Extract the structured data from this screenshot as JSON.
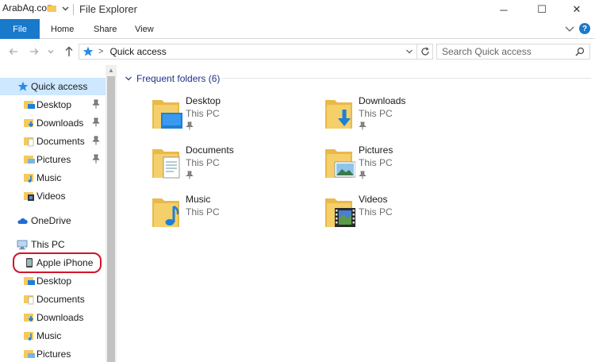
{
  "watermark": "ArabAq.com",
  "window": {
    "title": "File Explorer"
  },
  "window_controls": {
    "minimize": "─",
    "maximize": "☐",
    "close": "✕"
  },
  "ribbon": {
    "tabs": [
      {
        "label": "File",
        "active": true
      },
      {
        "label": "Home"
      },
      {
        "label": "Share"
      },
      {
        "label": "View"
      }
    ],
    "help": "?"
  },
  "address": {
    "crumb_sep": ">",
    "location": "Quick access",
    "search_placeholder": "Search Quick access"
  },
  "navpane": {
    "items": [
      {
        "label": "Quick access",
        "icon": "star-icon",
        "selected": true
      },
      {
        "label": "Desktop",
        "icon": "folder-desktop-icon",
        "pinned": true
      },
      {
        "label": "Downloads",
        "icon": "folder-downloads-icon",
        "pinned": true
      },
      {
        "label": "Documents",
        "icon": "folder-documents-icon",
        "pinned": true
      },
      {
        "label": "Pictures",
        "icon": "folder-pictures-icon",
        "pinned": true
      },
      {
        "label": "Music",
        "icon": "folder-music-icon"
      },
      {
        "label": "Videos",
        "icon": "folder-videos-icon"
      },
      {
        "label": "OneDrive",
        "icon": "cloud-icon"
      },
      {
        "label": "This PC",
        "icon": "computer-icon"
      },
      {
        "label": "Apple iPhone",
        "icon": "phone-icon"
      },
      {
        "label": "Desktop",
        "icon": "folder-desktop-icon"
      },
      {
        "label": "Documents",
        "icon": "folder-documents-icon"
      },
      {
        "label": "Downloads",
        "icon": "folder-downloads-icon"
      },
      {
        "label": "Music",
        "icon": "folder-music-icon"
      },
      {
        "label": "Pictures",
        "icon": "folder-pictures-icon"
      }
    ]
  },
  "frequent": {
    "header": "Frequent folders (6)",
    "folders": [
      {
        "name": "Desktop",
        "location": "This PC",
        "pinned": true
      },
      {
        "name": "Downloads",
        "location": "This PC",
        "pinned": true
      },
      {
        "name": "Documents",
        "location": "This PC",
        "pinned": true
      },
      {
        "name": "Pictures",
        "location": "This PC",
        "pinned": true
      },
      {
        "name": "Music",
        "location": "This PC",
        "pinned": false
      },
      {
        "name": "Videos",
        "location": "This PC",
        "pinned": false
      }
    ]
  },
  "colors": {
    "accent": "#1979ca",
    "selection": "#cde8ff",
    "folder": "#f4c95d",
    "highlight_ring": "#d0152b"
  }
}
